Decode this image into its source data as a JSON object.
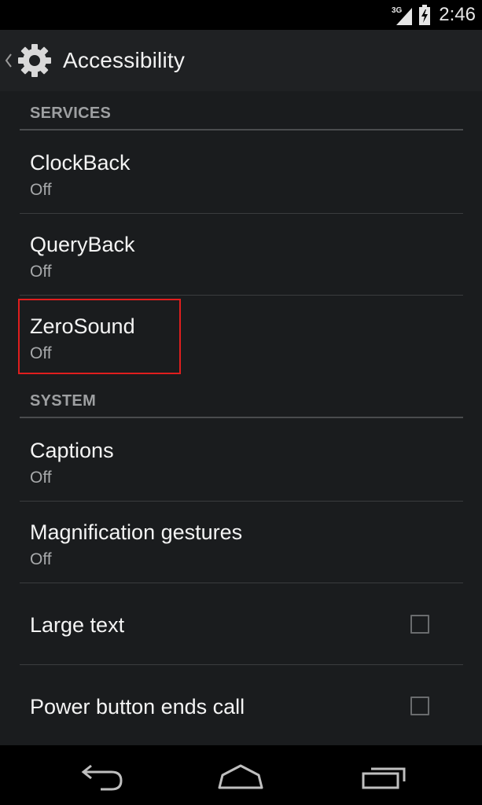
{
  "status_bar": {
    "network_label": "3G",
    "time": "2:46",
    "icons": [
      "signal-icon",
      "battery-icon"
    ]
  },
  "action_bar": {
    "title": "Accessibility",
    "icon": "settings-gear-icon"
  },
  "sections": {
    "services": {
      "header": "SERVICES",
      "items": [
        {
          "title": "ClockBack",
          "summary": "Off"
        },
        {
          "title": "QueryBack",
          "summary": "Off"
        },
        {
          "title": "ZeroSound",
          "summary": "Off"
        }
      ]
    },
    "system": {
      "header": "SYSTEM",
      "items": [
        {
          "title": "Captions",
          "summary": "Off"
        },
        {
          "title": "Magnification gestures",
          "summary": "Off"
        },
        {
          "title": "Large text",
          "checked": false
        },
        {
          "title": "Power button ends call",
          "checked": false
        }
      ]
    }
  },
  "highlight": {
    "target": "ZeroSound",
    "color": "#e01e1e"
  },
  "nav_bar": {
    "buttons": [
      "back-icon",
      "home-icon",
      "recents-icon"
    ]
  },
  "colors": {
    "background": "#1a1c1e",
    "action_bar": "#1f2123",
    "section_header_text": "#9ea0a2",
    "summary_text": "#a7a9ab"
  }
}
